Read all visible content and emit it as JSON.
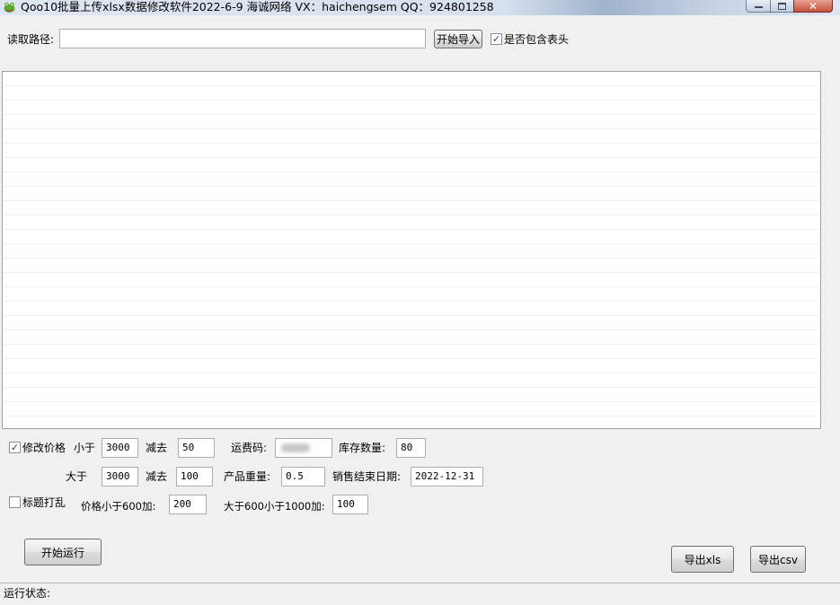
{
  "window": {
    "title": "Qoo10批量上传xlsx数据修改软件2022-6-9  海诚网络 VX：haichengsem QQ：924801258",
    "close_glyph": "✕"
  },
  "path": {
    "label": "读取路径:",
    "value": "",
    "import_button": "开始导入",
    "include_header_label": "是否包含表头",
    "include_header_checked": true
  },
  "price": {
    "modify_label": "修改价格",
    "modify_checked": true,
    "less_than_label": "小于",
    "less_than_value": "3000",
    "subtract_label_1": "减去",
    "subtract_value_1": "50",
    "greater_than_label": "大于",
    "greater_than_value": "3000",
    "subtract_label_2": "减去",
    "subtract_value_2": "100"
  },
  "shipping": {
    "code_label": "运费码:",
    "code_value": ""
  },
  "stock": {
    "label": "库存数量:",
    "value": "80"
  },
  "weight": {
    "label": "产品重量:",
    "value": "0.5"
  },
  "sale_end": {
    "label": "销售结束日期:",
    "value": "2022-12-31"
  },
  "title_shuffle": {
    "label": "标题打乱",
    "checked": false,
    "add_lt600_label": "价格小于600加:",
    "add_lt600_value": "200",
    "add_600_1000_label": "大于600小于1000加:",
    "add_600_1000_value": "100"
  },
  "actions": {
    "run_button": "开始运行",
    "export_xls_button": "导出xls",
    "export_csv_button": "导出csv"
  },
  "status": {
    "label": "运行状态:"
  }
}
